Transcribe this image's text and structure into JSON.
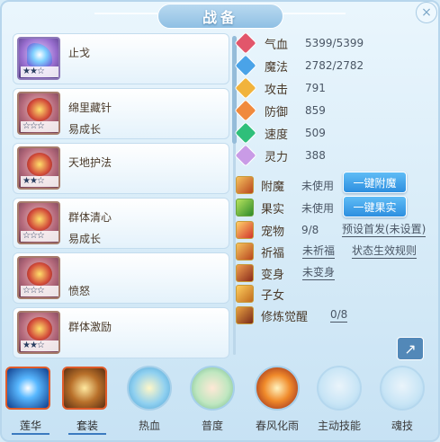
{
  "window": {
    "title": "战备",
    "close_icon": "×"
  },
  "cards": [
    {
      "name": "止戈",
      "sub": "",
      "stars": "★★☆",
      "icon": "purple-fan-icon"
    },
    {
      "name": "绵里藏针",
      "sub": "易成长",
      "stars": "☆☆☆",
      "icon": "needle-icon"
    },
    {
      "name": "天地护法",
      "sub": "",
      "stars": "★★☆",
      "icon": "guardian-icon"
    },
    {
      "name": "群体清心",
      "sub": "易成长",
      "stars": "☆☆☆",
      "icon": "cleanse-icon"
    },
    {
      "name": "愤怒",
      "sub": "",
      "stars": "☆☆☆",
      "icon": "fury-ring-icon"
    },
    {
      "name": "群体激励",
      "sub": "",
      "stars": "★★☆",
      "icon": "inspire-icon"
    }
  ],
  "stats": [
    {
      "label": "气血",
      "value": "5399/5399",
      "color": "#e2566b"
    },
    {
      "label": "魔法",
      "value": "2782/2782",
      "color": "#4aa3e8"
    },
    {
      "label": "攻击",
      "value": "791",
      "color": "#f1b33c"
    },
    {
      "label": "防御",
      "value": "859",
      "color": "#f08a3d"
    },
    {
      "label": "速度",
      "value": "509",
      "color": "#2fbf7a"
    },
    {
      "label": "灵力",
      "value": "388",
      "color": "#c99be6"
    }
  ],
  "functions": {
    "enchant": {
      "label": "附魔",
      "value": "未使用",
      "button": "一键附魔"
    },
    "fruit": {
      "label": "果实",
      "value": "未使用",
      "button": "一键果实"
    },
    "pet": {
      "label": "宠物",
      "value": "9/8",
      "link": "预设首发(未设置)"
    },
    "blessing": {
      "label": "祈福",
      "value": "未祈福",
      "link": "状态生效规则"
    },
    "transform": {
      "label": "变身",
      "value": "未变身"
    },
    "child": {
      "label": "子女"
    },
    "cultivation": {
      "label": "修炼觉醒",
      "value": "0/8"
    }
  },
  "share_icon": "share-icon",
  "tabs": [
    {
      "label": "莲华",
      "active": true
    },
    {
      "label": "套装",
      "active": true
    },
    {
      "label": "热血",
      "active": false
    },
    {
      "label": "普度",
      "active": false
    },
    {
      "label": "春风化雨",
      "active": false
    },
    {
      "label": "主动技能",
      "active": false
    },
    {
      "label": "魂技",
      "active": false
    }
  ]
}
